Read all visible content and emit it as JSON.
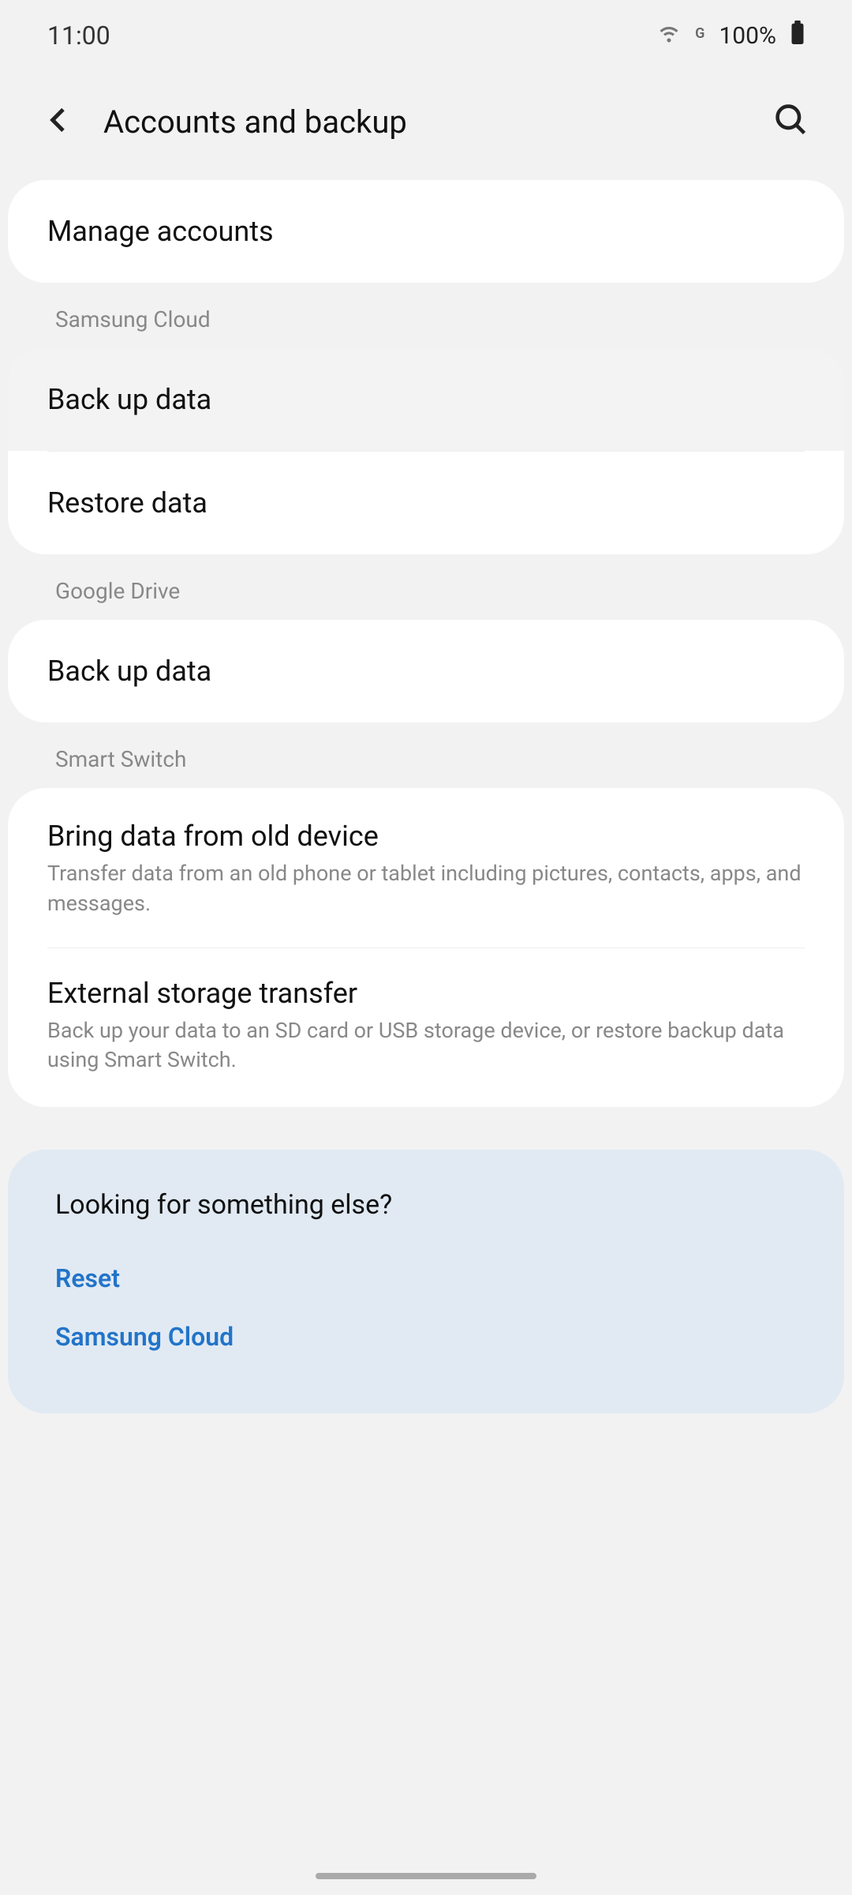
{
  "status": {
    "time": "11:00",
    "network": "G",
    "battery": "100%"
  },
  "header": {
    "title": "Accounts and backup"
  },
  "sections": {
    "top": {
      "manage_accounts": "Manage accounts"
    },
    "samsung_cloud": {
      "header": "Samsung Cloud",
      "back_up": "Back up data",
      "restore": "Restore data"
    },
    "google_drive": {
      "header": "Google Drive",
      "back_up": "Back up data"
    },
    "smart_switch": {
      "header": "Smart Switch",
      "bring_data": {
        "title": "Bring data from old device",
        "subtitle": "Transfer data from an old phone or tablet including pictures, contacts, apps, and messages."
      },
      "external": {
        "title": "External storage transfer",
        "subtitle": "Back up your data to an SD card or USB storage device, or restore backup data using Smart Switch."
      }
    }
  },
  "related": {
    "title": "Looking for something else?",
    "links": {
      "reset": "Reset",
      "samsung_cloud": "Samsung Cloud"
    }
  }
}
